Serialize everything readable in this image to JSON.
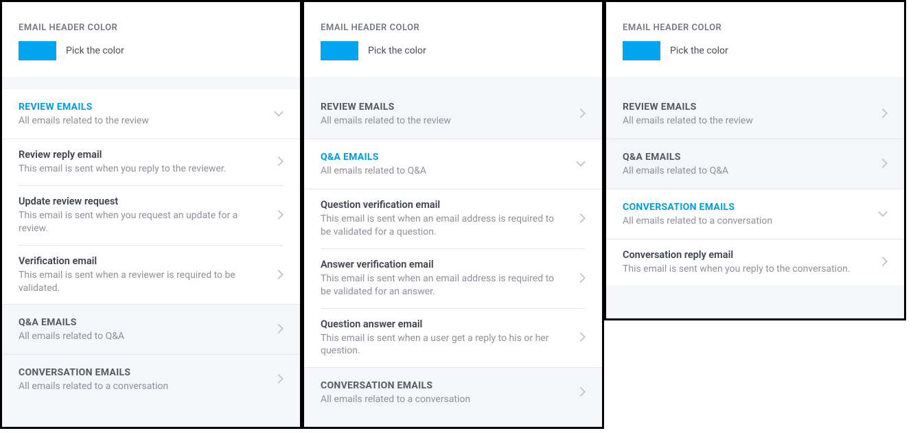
{
  "header": {
    "label": "EMAIL HEADER COLOR",
    "pick": "Pick the color",
    "swatch_color": "#00a4ef"
  },
  "groups": {
    "review": {
      "title": "REVIEW EMAILS",
      "sub": "All emails related to the review"
    },
    "qa": {
      "title": "Q&A EMAILS",
      "sub": "All emails related to Q&A"
    },
    "conversation": {
      "title": "CONVERSATION EMAILS",
      "sub": "All emails related to a conversation"
    }
  },
  "items": {
    "review_reply": {
      "title": "Review reply email",
      "sub": "This email is sent when you reply to the reviewer."
    },
    "update_review": {
      "title": "Update review request",
      "sub": "This email is sent when you request an update for a review."
    },
    "verification": {
      "title": "Verification email",
      "sub": "This email is sent when a reviewer is required to be validated."
    },
    "question_verify": {
      "title": "Question verification email",
      "sub": "This email is sent when an email address is required to be validated for a question."
    },
    "answer_verify": {
      "title": "Answer verification email",
      "sub": "This email is sent when an email address is required to be validated for an answer."
    },
    "question_answer": {
      "title": "Question answer email",
      "sub": "This email is sent when a user get a reply to his or her question."
    },
    "conversation_reply": {
      "title": "Conversation reply email",
      "sub": "This email is sent when you reply to the conversation."
    }
  }
}
